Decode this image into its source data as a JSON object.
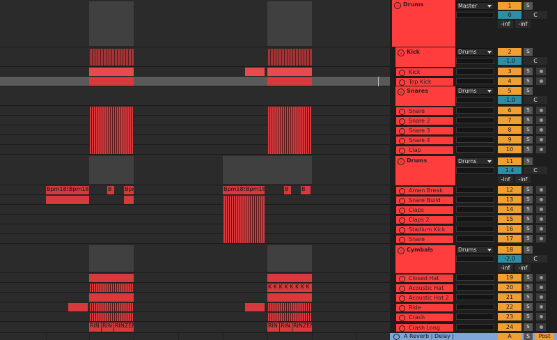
{
  "tracks": [
    {
      "kind": "group",
      "name": "Drums",
      "route": "Master",
      "num": "1",
      "solo": "S",
      "vol": "0",
      "pan": "C",
      "meterL": "-inf",
      "meterR": "-inf"
    },
    {
      "kind": "group",
      "name": "Kick",
      "route": "Drums",
      "num": "2",
      "solo": "S",
      "vol": "-1.0",
      "pan": "C"
    },
    {
      "kind": "track",
      "name": "Kick",
      "num": "3",
      "solo": "S"
    },
    {
      "kind": "track",
      "name": "Top Kick",
      "num": "4",
      "solo": "S"
    },
    {
      "kind": "group",
      "name": "Snares",
      "route": "Drums",
      "num": "5",
      "solo": "S",
      "vol": "-1.0",
      "pan": "C"
    },
    {
      "kind": "track",
      "name": "Snare",
      "num": "6",
      "solo": "S"
    },
    {
      "kind": "track",
      "name": "Snare 2",
      "num": "7",
      "solo": "S"
    },
    {
      "kind": "track",
      "name": "Snare 3",
      "num": "8",
      "solo": "S"
    },
    {
      "kind": "track",
      "name": "Snare 4",
      "num": "9",
      "solo": "S"
    },
    {
      "kind": "track",
      "name": "Clap",
      "num": "10",
      "solo": "S"
    },
    {
      "kind": "group",
      "name": "Drums",
      "route": "Drums",
      "num": "11",
      "solo": "S",
      "vol": "1.4",
      "pan": "C",
      "meterL": "-inf",
      "meterR": "-inf"
    },
    {
      "kind": "track",
      "name": "Amen Break",
      "num": "12",
      "solo": "S"
    },
    {
      "kind": "track",
      "name": "Snare Build",
      "num": "13",
      "solo": "S"
    },
    {
      "kind": "track",
      "name": "Claps",
      "num": "14",
      "solo": "S"
    },
    {
      "kind": "track",
      "name": "Claps 2",
      "num": "15",
      "solo": "S"
    },
    {
      "kind": "track",
      "name": "Stadium Kick",
      "num": "16",
      "solo": "S"
    },
    {
      "kind": "track",
      "name": "Snare",
      "num": "17",
      "solo": "S"
    },
    {
      "kind": "group",
      "name": "Cymbals",
      "route": "Drums",
      "num": "18",
      "solo": "S",
      "vol": "-2.0",
      "pan": "C",
      "meterL": "-inf",
      "meterR": "-inf"
    },
    {
      "kind": "track",
      "name": "Closed Hat",
      "num": "19",
      "solo": "S"
    },
    {
      "kind": "track",
      "name": "Acoustic Hat",
      "num": "20",
      "solo": "S"
    },
    {
      "kind": "track",
      "name": "Acoustic Hat 2",
      "num": "21",
      "solo": "S"
    },
    {
      "kind": "track",
      "name": "Ride",
      "num": "22",
      "solo": "S"
    },
    {
      "kind": "track",
      "name": "Crash",
      "num": "23",
      "solo": "S"
    },
    {
      "kind": "track",
      "name": "Crash Long",
      "num": "24",
      "solo": "S"
    }
  ],
  "clip_labels": {
    "bpm_a": "Bpm185",
    "bpm_b": "Bpm18",
    "b_short": "B",
    "bpm_c": "Bpm",
    "bpm_d": "Bpm185",
    "bpm_e": "Bpm18",
    "k_row": "K K K K K K K K K",
    "rin_a": "RIN",
    "rin_b": "RIN",
    "rin_c": "RINZEN",
    "rin_d": "RIN",
    "rin_e": "RIN",
    "rin_f": "RINZEN"
  },
  "return_track": {
    "name": "A Reverb | Delay |",
    "num": "A",
    "solo": "S",
    "post": "Post"
  },
  "colors": {
    "track": "#ff3d3d",
    "clip": "#d9393c",
    "number": "#f0a033",
    "volume": "#2e8ea6",
    "return": "#7ea7d8"
  }
}
